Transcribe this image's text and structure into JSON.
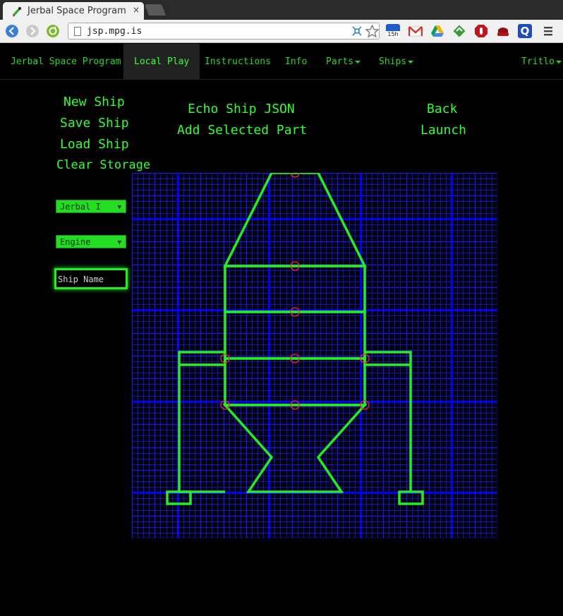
{
  "browser": {
    "tab_title": "Jerbal Space Program",
    "tab_close": "×",
    "url": "jsp.mpg.is",
    "calendar_badge": "15h"
  },
  "nav": {
    "brand": "Jerbal Space Program",
    "items": [
      "Local Play",
      "Instructions",
      "Info",
      "Parts",
      "Ships",
      "Tritlo"
    ],
    "active": "Local Play"
  },
  "controls": {
    "new_ship": "New Ship",
    "save_ship": "Save Ship",
    "load_ship": "Load Ship",
    "clear_storage": "Clear Storage",
    "echo_json": "Echo Ship JSON",
    "add_part": "Add Selected Part",
    "back": "Back",
    "launch": "Launch",
    "pilot_select": "Jerbal I",
    "part_select": "Engine",
    "ship_name_placeholder": "Ship Name"
  },
  "colors": {
    "accent": "#33ff33",
    "grid_fine": "#1a1acc",
    "grid_major": "#0000ff",
    "ship": "#22ee22",
    "attach_node": "#ff2222"
  },
  "icons": [
    "tab-favicon-icon",
    "back-icon",
    "forward-icon",
    "reload-icon",
    "page-icon",
    "translate-icon",
    "star-icon",
    "calendar-icon",
    "gmail-icon",
    "drive-icon",
    "extension-icon",
    "adblock-icon",
    "pocket-icon",
    "q-icon",
    "menu-icon"
  ]
}
